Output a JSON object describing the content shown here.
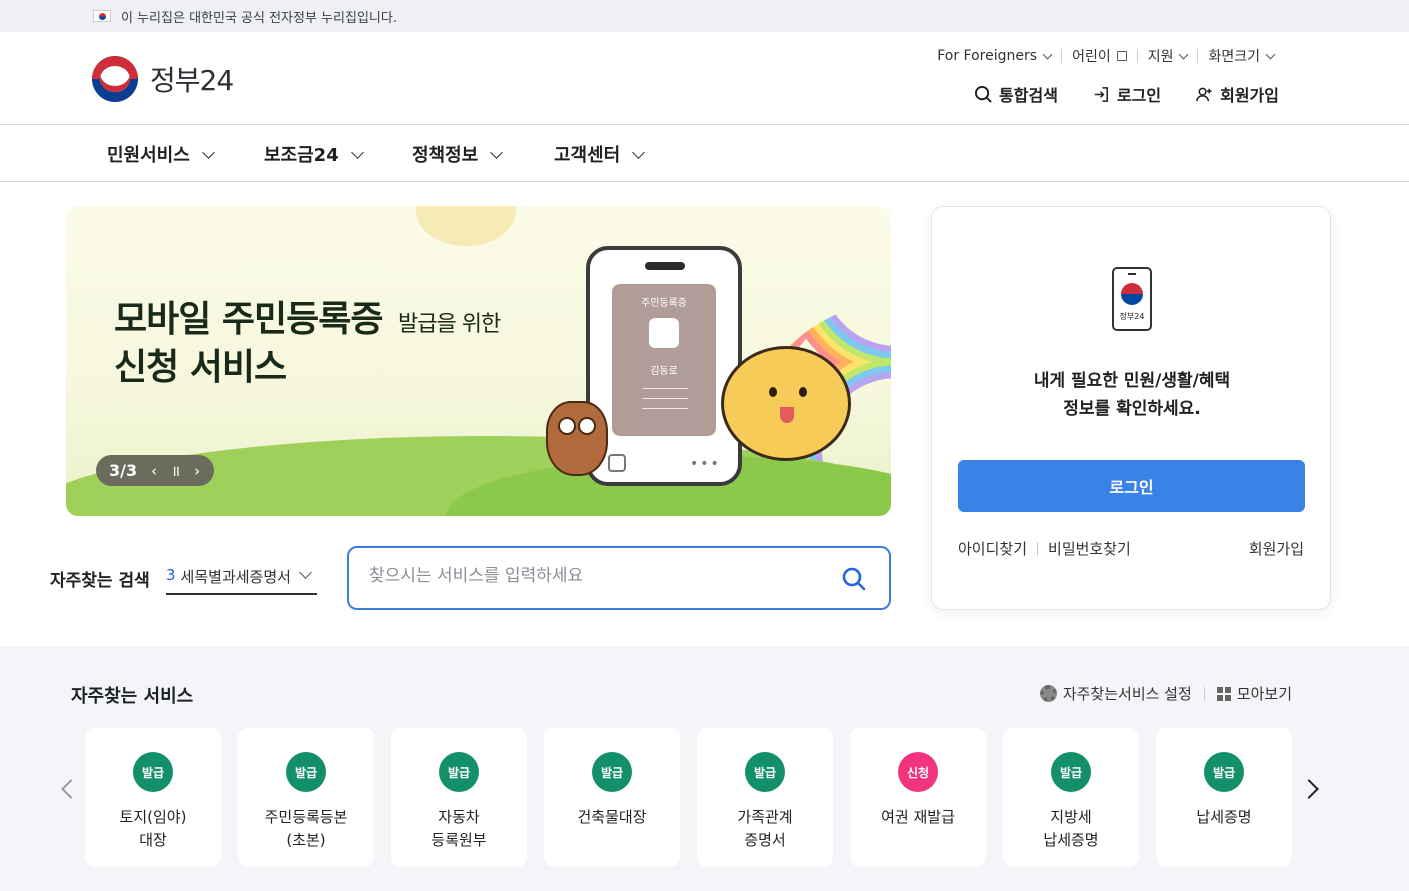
{
  "gov_banner": {
    "text": "이 누리집은 대한민국 공식 전자정부 누리집입니다."
  },
  "logo": {
    "text": "정부24"
  },
  "util_links": [
    "For Foreigners",
    "어린이",
    "지원",
    "화면크기"
  ],
  "actions": {
    "search": "통합검색",
    "login": "로그인",
    "signup": "회원가입"
  },
  "nav": [
    "민원서비스",
    "보조금24",
    "정책정보",
    "고객센터"
  ],
  "hero": {
    "title_bold": "모바일 주민등록증",
    "title_small": "발급을 위한",
    "title_line2": "신청 서비스",
    "card_title": "주민등록증",
    "card_name": "김동로",
    "slide_indicator": "3/3"
  },
  "quick_search": {
    "label": "자주찾는 검색",
    "selected_num": "3",
    "selected_text": "세목별과세증명서",
    "placeholder": "찾으시는 서비스를 입력하세요"
  },
  "login_panel": {
    "logo_text": "정부24",
    "message_line1": "내게 필요한 민원/생활/혜택",
    "message_line2": "정보를 확인하세요.",
    "button": "로그인",
    "find_id": "아이디찾기",
    "find_pw": "비밀번호찾기",
    "join": "회원가입"
  },
  "favorites": {
    "title": "자주찾는 서비스",
    "settings": "자주찾는서비스 설정",
    "view_all": "모아보기",
    "items": [
      {
        "badge": "발급",
        "line1": "토지(임야)",
        "line2": "대장",
        "color": "#13906a"
      },
      {
        "badge": "발급",
        "line1": "주민등록등본",
        "line2": "(초본)",
        "color": "#13906a"
      },
      {
        "badge": "발급",
        "line1": "자동차",
        "line2": "등록원부",
        "color": "#13906a"
      },
      {
        "badge": "발급",
        "line1": "건축물대장",
        "line2": "",
        "color": "#13906a"
      },
      {
        "badge": "발급",
        "line1": "가족관계",
        "line2": "증명서",
        "color": "#13906a"
      },
      {
        "badge": "신청",
        "line1": "여권 재발급",
        "line2": "",
        "color": "#f0357e"
      },
      {
        "badge": "발급",
        "line1": "지방세",
        "line2": "납세증명",
        "color": "#13906a"
      },
      {
        "badge": "발급",
        "line1": "납세증명",
        "line2": "",
        "color": "#13906a"
      }
    ]
  }
}
